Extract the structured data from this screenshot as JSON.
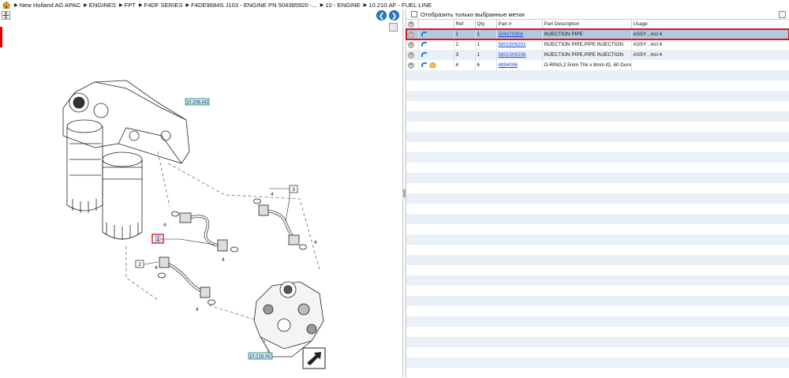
{
  "breadcrumb": [
    "New Holland AG APAC",
    "ENGINES",
    "FPT",
    "F4DF SERIES",
    "F4DE9684S J103 - ENGINE PN 504385920 -...",
    "10 - ENGINE",
    "10.210.AF - FUEL LINE"
  ],
  "diagram": {
    "ref_tags": {
      "top": "10.206.AG",
      "bottom": "10.218.AC"
    },
    "callouts": {
      "c1": "1",
      "c2": "2",
      "c3": "3",
      "c4a": "4",
      "c4b": "4",
      "c4c": "4",
      "c4d": "4",
      "c4e": "4",
      "c4f": "4"
    }
  },
  "filter": {
    "label": "Отобразить только выбранные метки"
  },
  "table": {
    "headers": {
      "ref": "Ref",
      "qty": "Qty",
      "part": "Part #",
      "desc": "Part Description",
      "usage": "Usage"
    },
    "rows": [
      {
        "ref": "1",
        "qty": "1",
        "part": "504375906",
        "desc": "INJECTION PIPE",
        "usage": "ASSY , incl 4"
      },
      {
        "ref": "2",
        "qty": "1",
        "part": "5801506201",
        "desc": "INJECTION PIPE,PIPE  INJECTION",
        "usage": "ASSY , incl 4"
      },
      {
        "ref": "3",
        "qty": "1",
        "part": "5801506206",
        "desc": "INJECTION PIPE,PIPE INJECTION",
        "usage": "ASSY , incl 4"
      },
      {
        "ref": "4",
        "qty": "6",
        "part": "4894096",
        "desc": "O-RING,2.5mm Thk x 8mm ID, 60 Duro",
        "usage": ""
      }
    ]
  },
  "colors": {
    "selection_outline": "#d21a1a",
    "selected_row": "#b3c9e2",
    "alt_row": "#eaf0f7",
    "link": "#1a44d4",
    "nav_button": "#2f7ac7",
    "ref_tag_fill": "#cdeee6"
  }
}
